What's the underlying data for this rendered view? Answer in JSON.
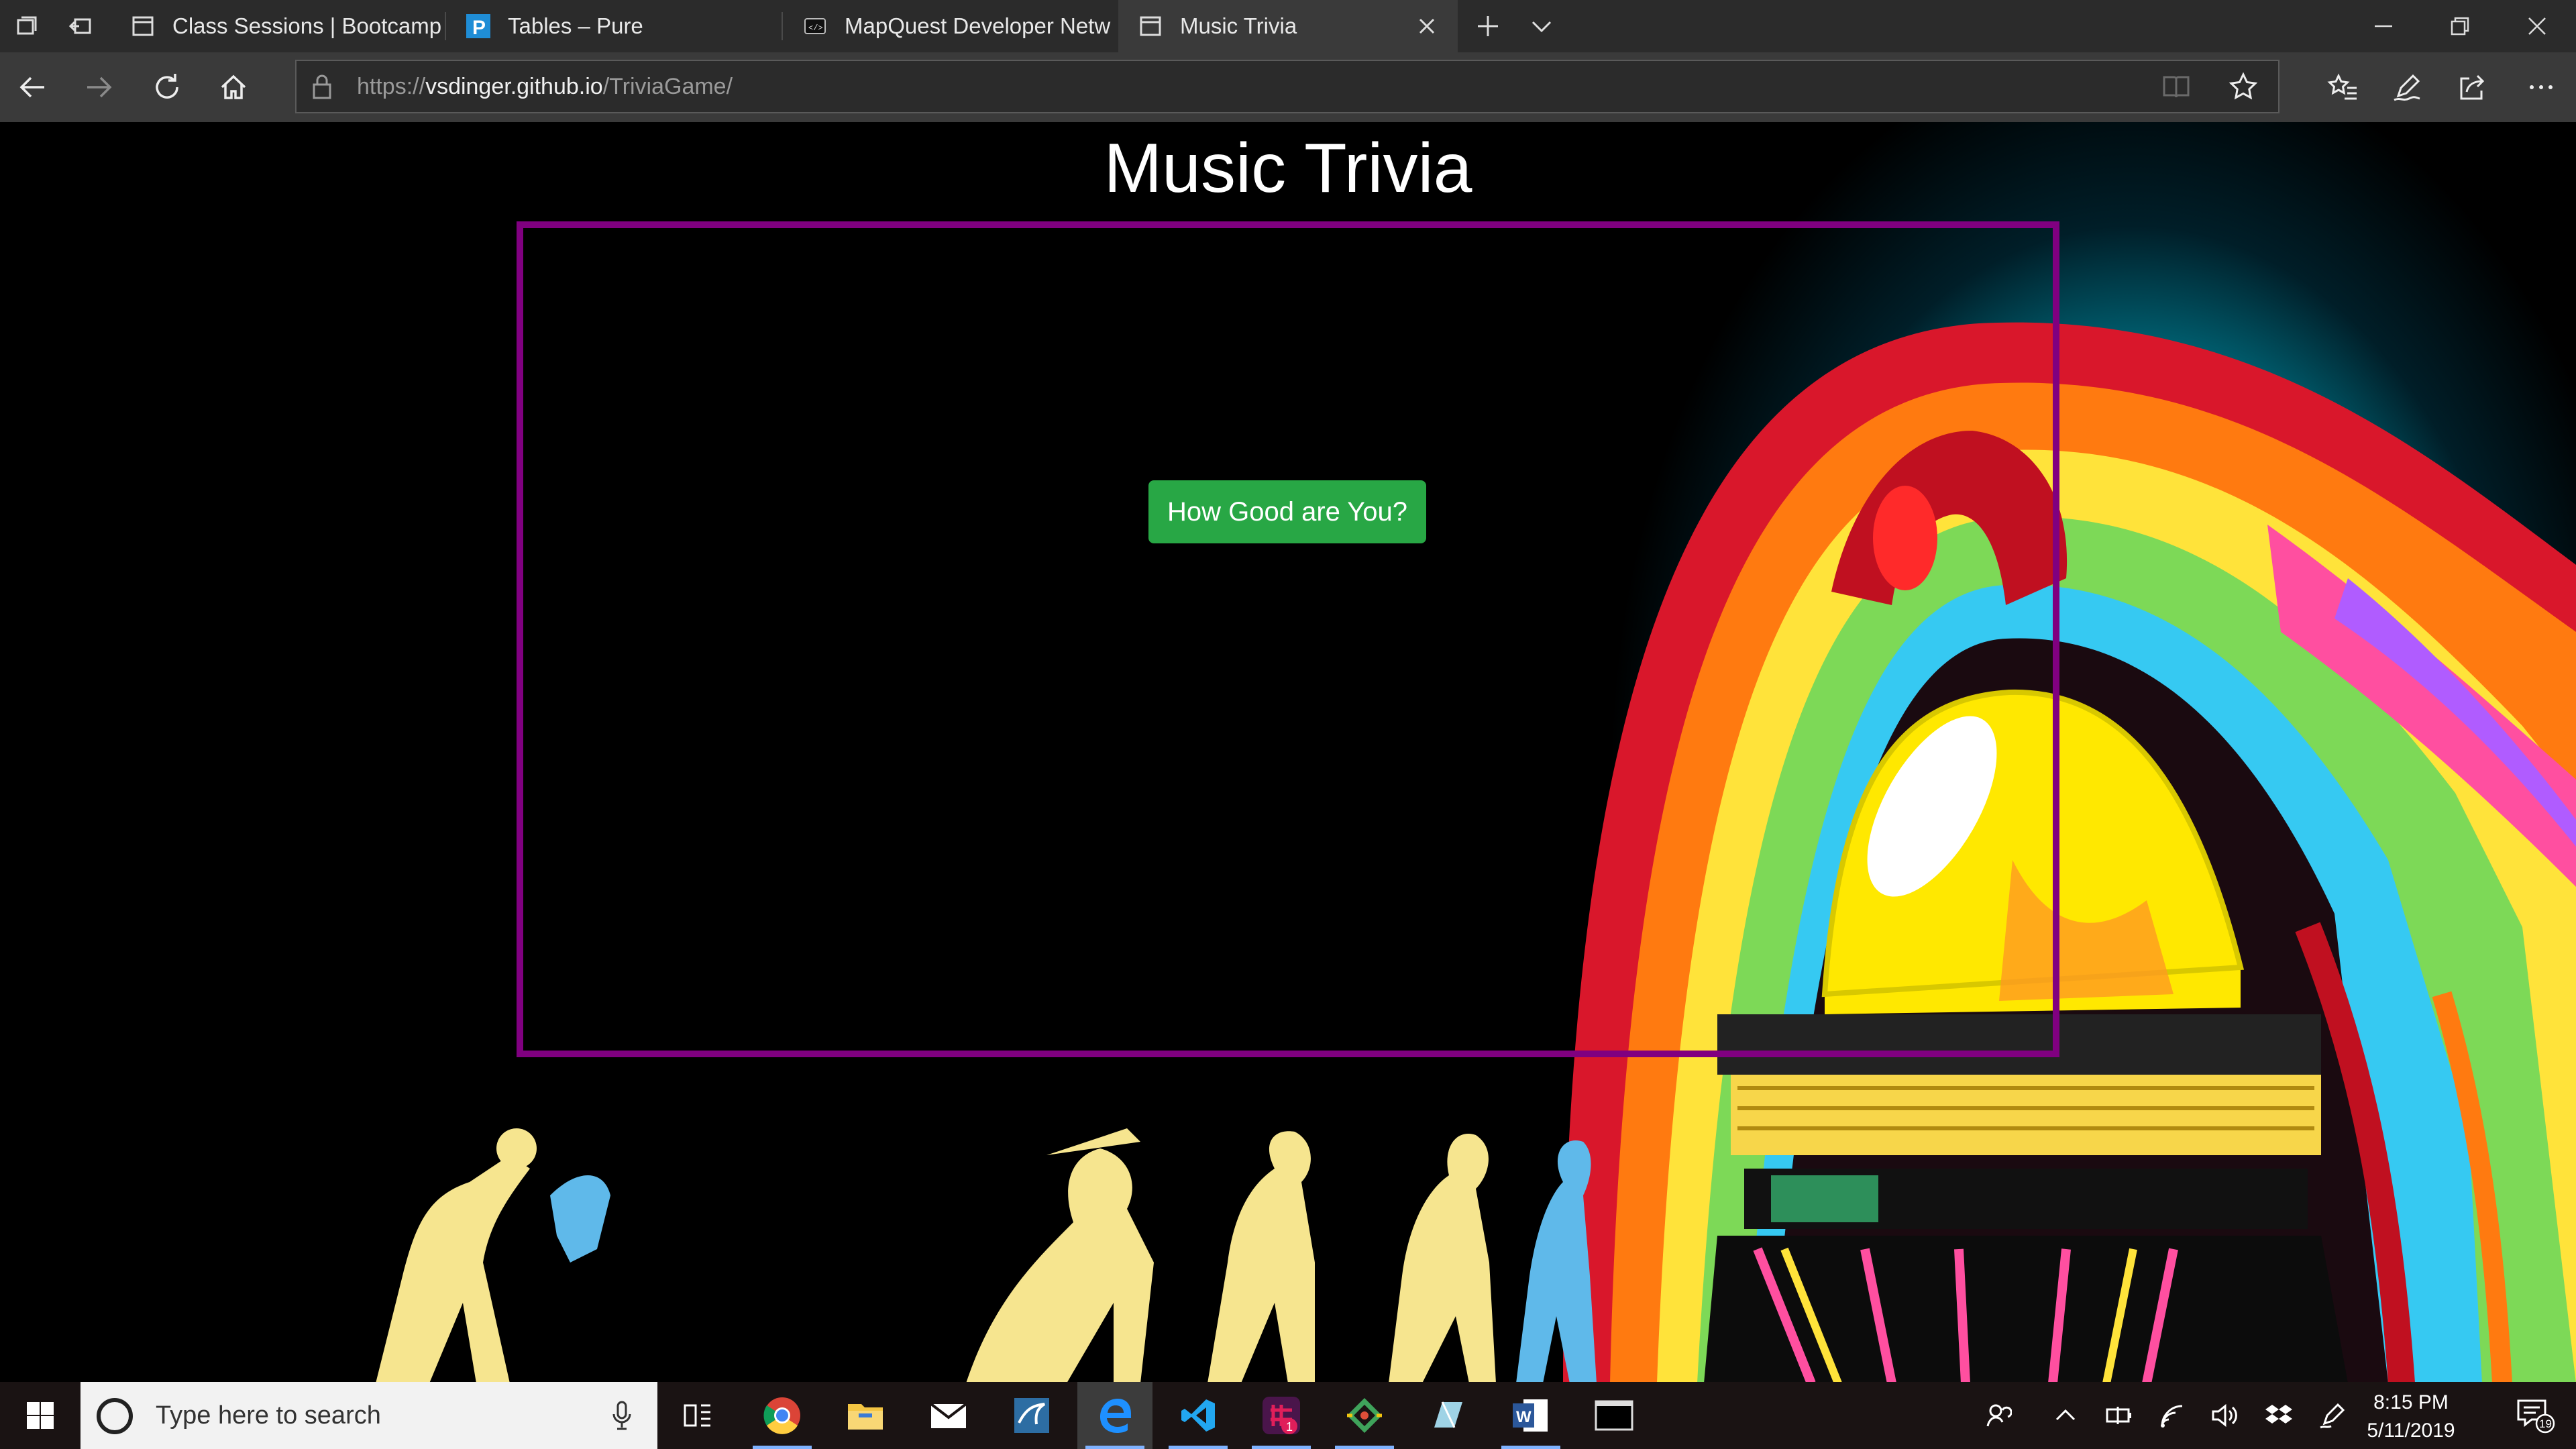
{
  "browser": {
    "tabs": [
      {
        "title": "Class Sessions | Bootcamp S",
        "favicon": "page-icon"
      },
      {
        "title": "Tables – Pure",
        "favicon": "pure-p-icon"
      },
      {
        "title": "MapQuest Developer Netw",
        "favicon": "mapquest-icon"
      },
      {
        "title": "Music Trivia",
        "favicon": "page-icon",
        "active": true
      }
    ],
    "address": {
      "prefix": "https://",
      "domain": "vsdinger.github.io",
      "path": "/TriviaGame/"
    }
  },
  "page": {
    "title": "Music Trivia",
    "start_button": "How Good are You?",
    "colors": {
      "box_border": "#800080",
      "button": "#28a745"
    }
  },
  "taskbar": {
    "search_placeholder": "Type here to search",
    "time": "8:15 PM",
    "date": "5/11/2019",
    "slack_badge": "1",
    "notification_count": "19"
  }
}
